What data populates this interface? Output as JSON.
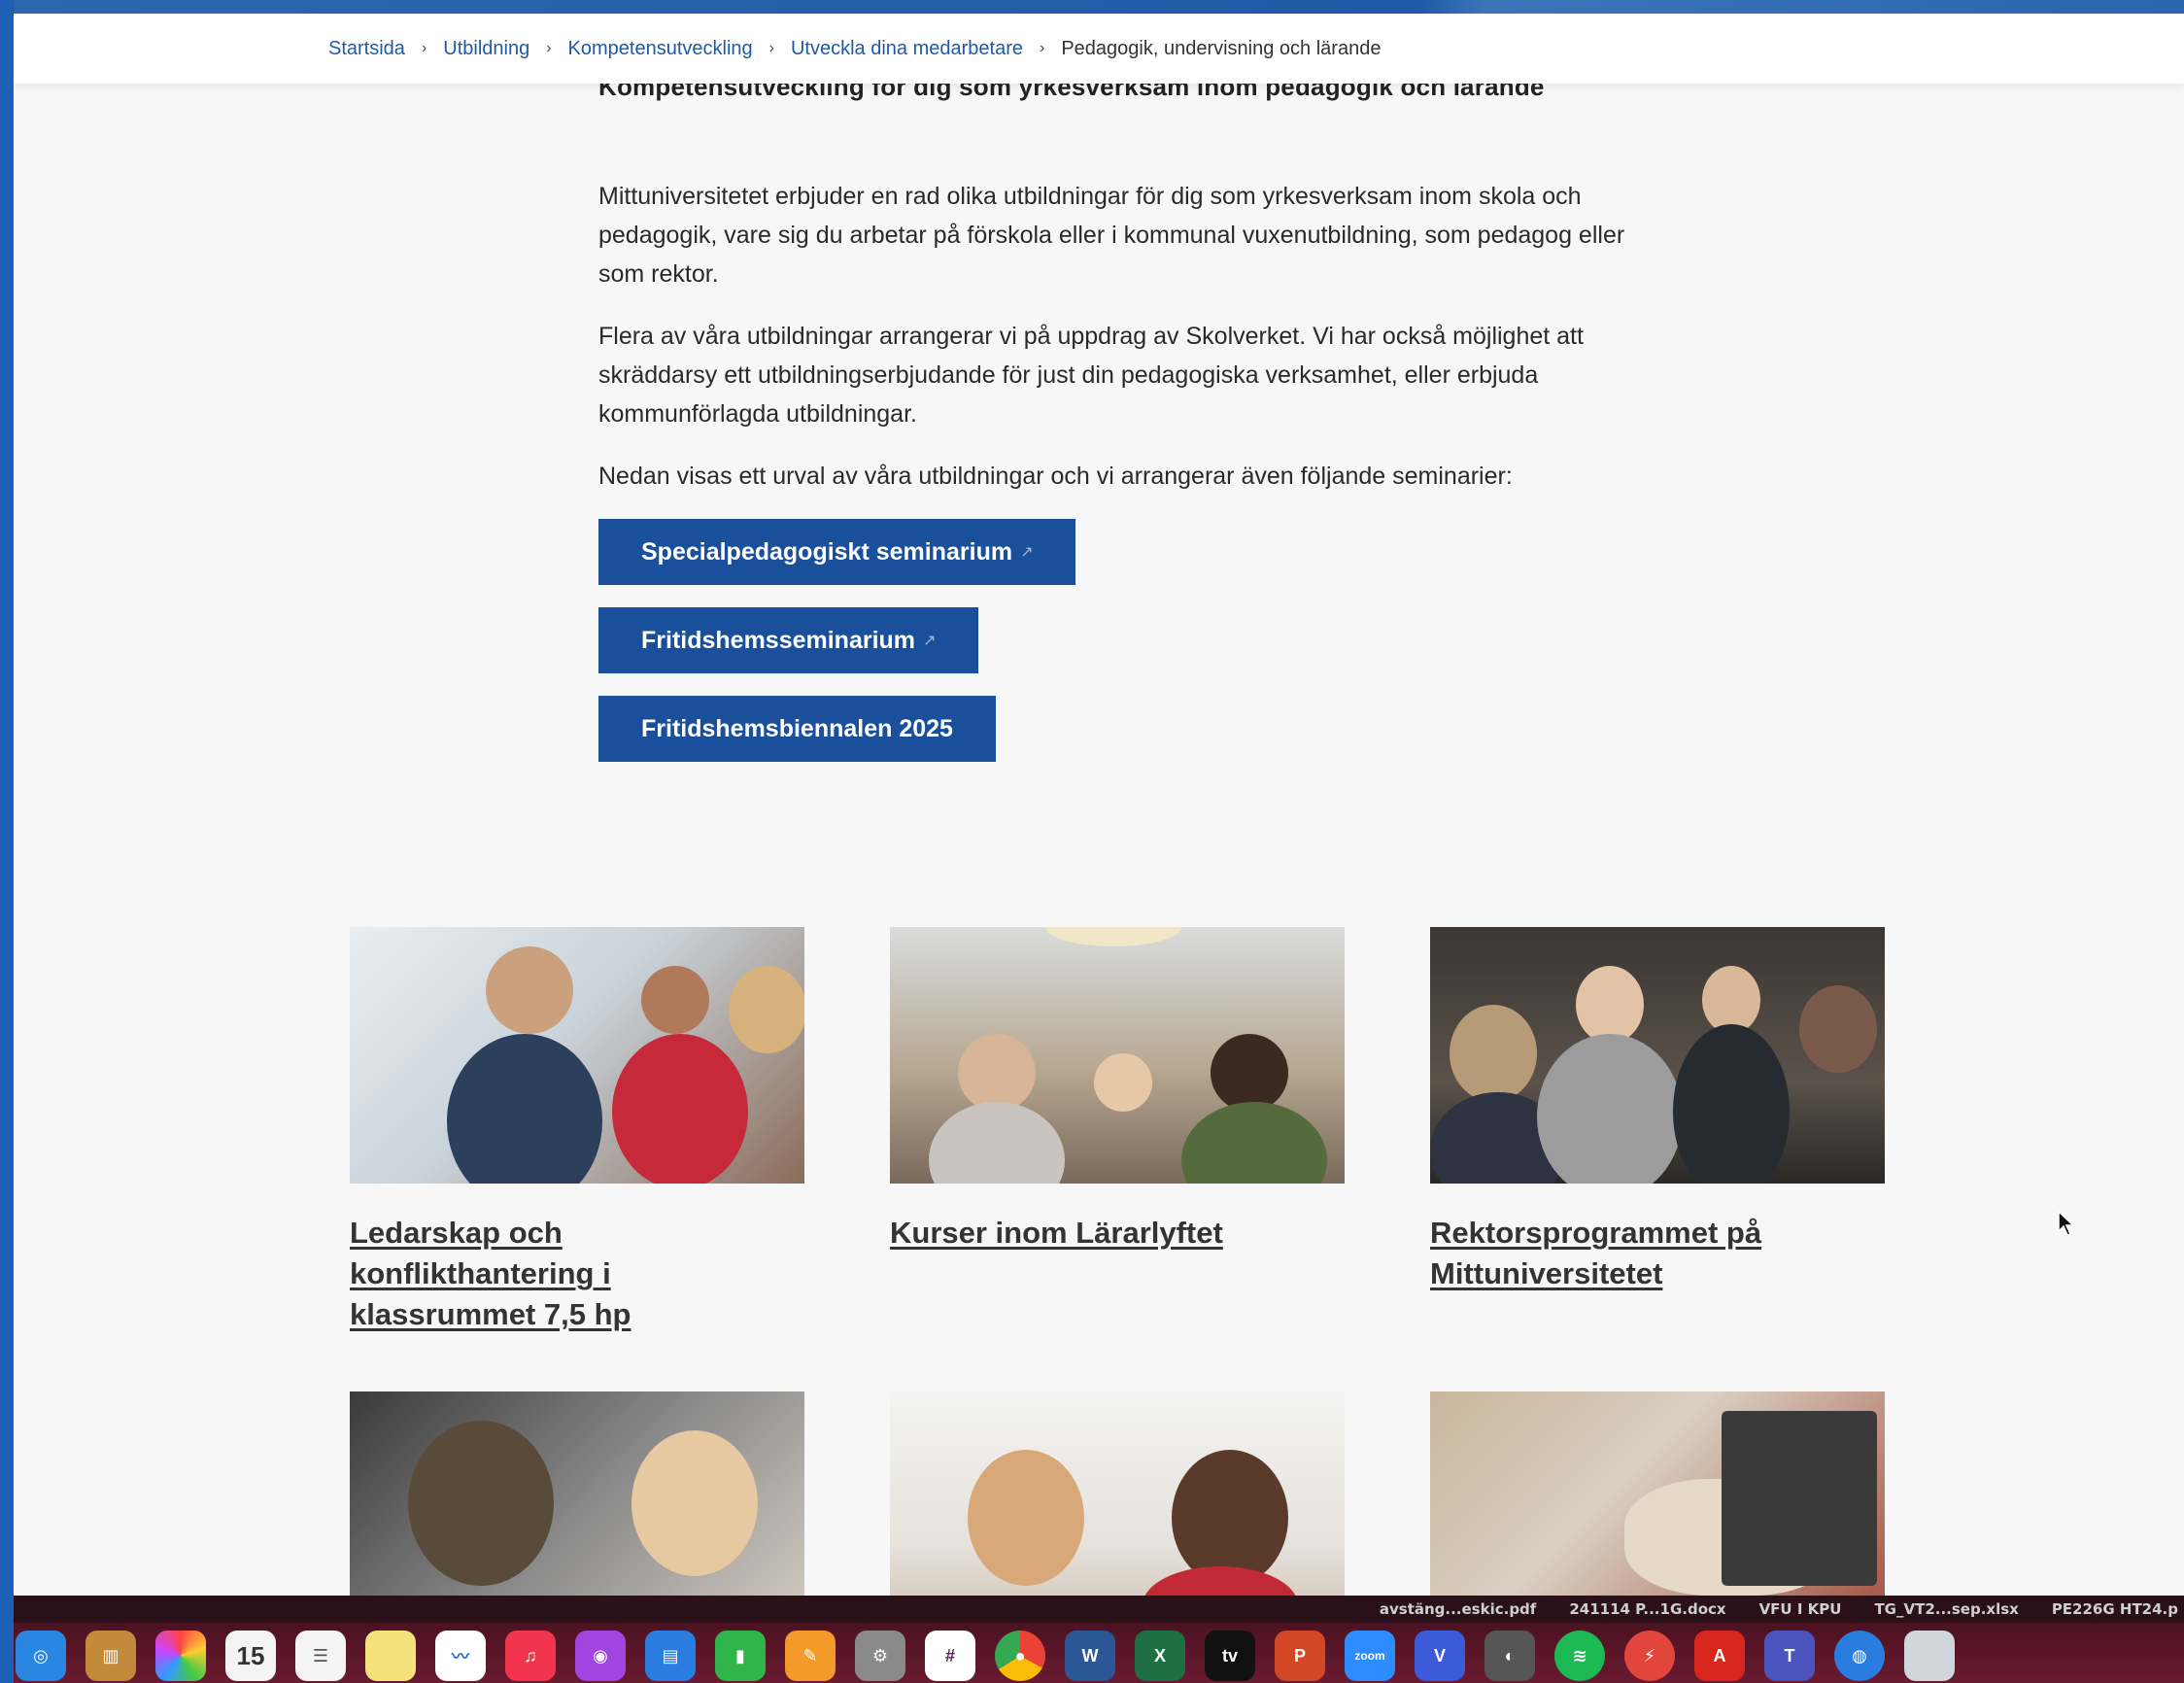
{
  "breadcrumb": [
    {
      "label": "Startsida"
    },
    {
      "label": "Utbildning"
    },
    {
      "label": "Kompetensutveckling"
    },
    {
      "label": "Utveckla dina medarbetare"
    },
    {
      "label": "Pedagogik, undervisning och lärande"
    }
  ],
  "page": {
    "heading": "Kompetensutveckling för dig som yrkesverksam inom pedagogik och lärande",
    "paragraphs": [
      "Mittuniversitetet erbjuder en rad olika utbildningar för dig som yrkesverksam inom skola och pedagogik, vare sig du arbetar på förskola eller i kommunal vuxenutbildning, som pedagog eller som rektor.",
      "Flera av våra utbildningar arrangerar vi på uppdrag av Skolverket. Vi har också möjlighet att skräddarsy ett utbildningserbjudande för just din pedagogiska verksamhet, eller erbjuda kommunförlagda utbildningar.",
      "Nedan visas ett urval av våra utbildningar och vi arrangerar även följande seminarier:"
    ],
    "buttons": [
      {
        "label": "Specialpedagogiskt seminarium"
      },
      {
        "label": "Fritidshemsseminarium"
      },
      {
        "label": "Fritidshemsbiennalen 2025"
      }
    ],
    "cards": [
      {
        "title": "Ledarskap och konflikthantering i klassrummet 7,5 hp"
      },
      {
        "title": "Kurser inom Lärarlyftet"
      },
      {
        "title": "Rektorsprogrammet på Mittuniversitetet"
      }
    ]
  },
  "dock": {
    "labels": [
      "avstäng...eskic.pdf",
      "241114 P...1G.docx",
      "VFU I KPU",
      "TG_VT2...sep.xlsx",
      "PE226G HT24.p"
    ],
    "calendar_day": "15",
    "icons": [
      "safari-icon",
      "finder-icon",
      "photos-icon",
      "calendar-icon",
      "reminders-icon",
      "notes-icon",
      "freeform-icon",
      "music-icon",
      "podcasts-icon",
      "keynote-icon",
      "numbers-icon",
      "pages-icon",
      "settings-icon",
      "slack-icon",
      "chrome-icon",
      "word-icon",
      "excel-icon",
      "appletv-icon",
      "powerpoint-icon",
      "zoom-icon",
      "vpn-icon",
      "preview-icon",
      "spotify-icon",
      "remote-icon",
      "acrobat-icon",
      "teams-icon",
      "globe-icon",
      "files-icon"
    ]
  },
  "colors": {
    "link": "#1f5aa6",
    "button": "#1a4f9c",
    "frame": "#1c5fb3"
  }
}
